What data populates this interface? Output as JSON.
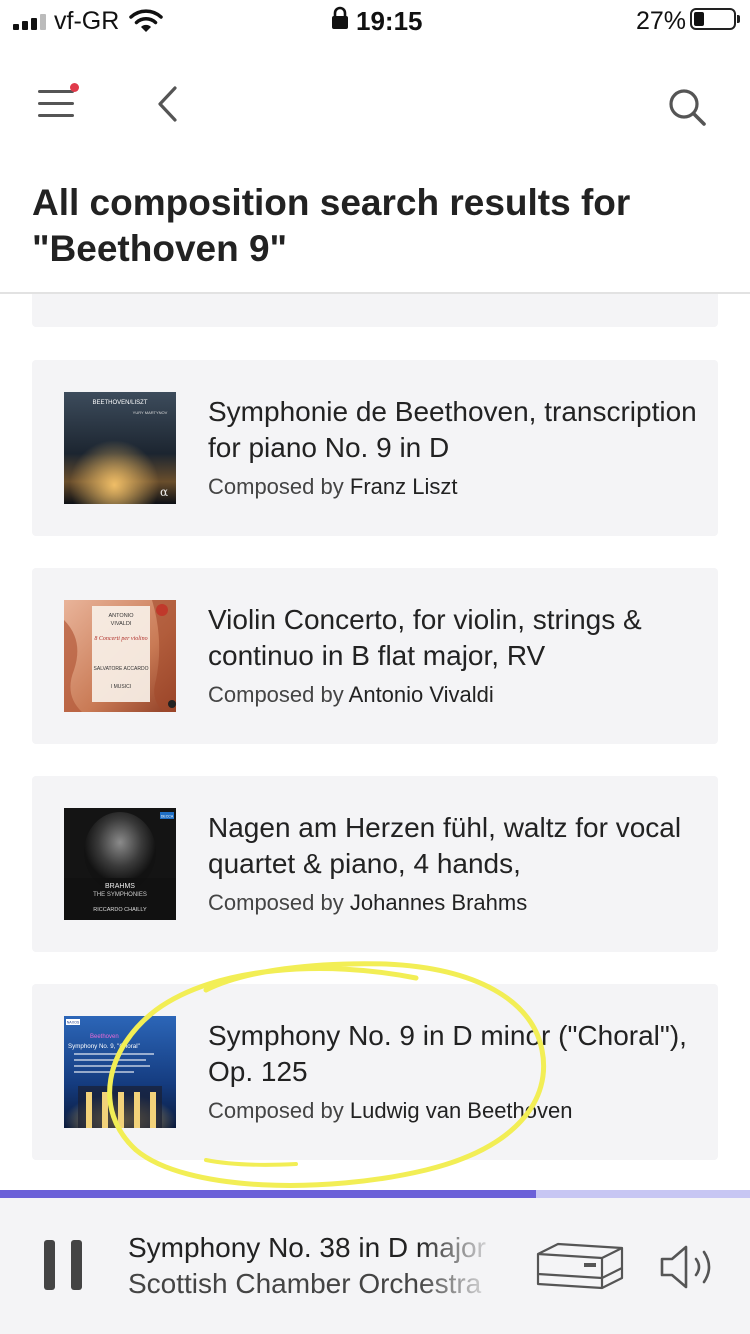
{
  "status_bar": {
    "carrier": "vf-GR",
    "time": "19:15",
    "battery_percent_label": "27%",
    "battery_level": 0.27
  },
  "nav": {
    "menu_icon": "hamburger-menu-icon",
    "notification_color": "#e03a4a",
    "back_icon": "chevron-left-icon",
    "search_icon": "search-icon"
  },
  "page": {
    "title": "All composition search results for \"Beethoven 9\""
  },
  "results": [
    {
      "title": "Symphonie de Beethoven, transcription for piano No. 9 in D",
      "composed_by_label": "Composed by",
      "composer": "Franz Liszt",
      "cover": {
        "line1": "BEETHOVEN/LISZT",
        "line2": "YURY MARTYNOV",
        "mark": "α"
      }
    },
    {
      "title": "Violin Concerto, for violin, strings & continuo in B flat major, RV",
      "composed_by_label": "Composed by",
      "composer": "Antonio Vivaldi",
      "cover": {
        "line1": "ANTONIO",
        "line2": "VIVALDI",
        "line3": "8 Concerti per violino",
        "line4": "SALVATORE ACCARDO",
        "line5": "I MUSICI"
      }
    },
    {
      "title": "Nagen am Herzen fühl, waltz for vocal quartet & piano, 4 hands,",
      "composed_by_label": "Composed by",
      "composer": "Johannes Brahms",
      "cover": {
        "line1": "BRAHMS",
        "line2": "THE SYMPHONIES",
        "line3": "RICCARDO CHAILLY",
        "badge": "DECCA"
      }
    },
    {
      "title": "Symphony No. 9 in D minor (\"Choral\"), Op. 125",
      "composed_by_label": "Composed by",
      "composer": "Ludwig van Beethoven",
      "cover": {
        "line1": "Beethoven",
        "line2": "Symphony No. 9, \"Choral\"",
        "badge": "NAXOS"
      },
      "highlighted": true
    }
  ],
  "highlight_color": "#f2ee55",
  "now_playing": {
    "title": "Symphony No. 38 in D major",
    "artist": "Scottish Chamber Orchestra",
    "progress": 0.715,
    "progress_color": "#6b60d8",
    "track_color": "#c7c6f3",
    "pause_icon": "pause-icon",
    "device_icon": "streamer-device-icon",
    "volume_icon": "speaker-volume-icon"
  }
}
